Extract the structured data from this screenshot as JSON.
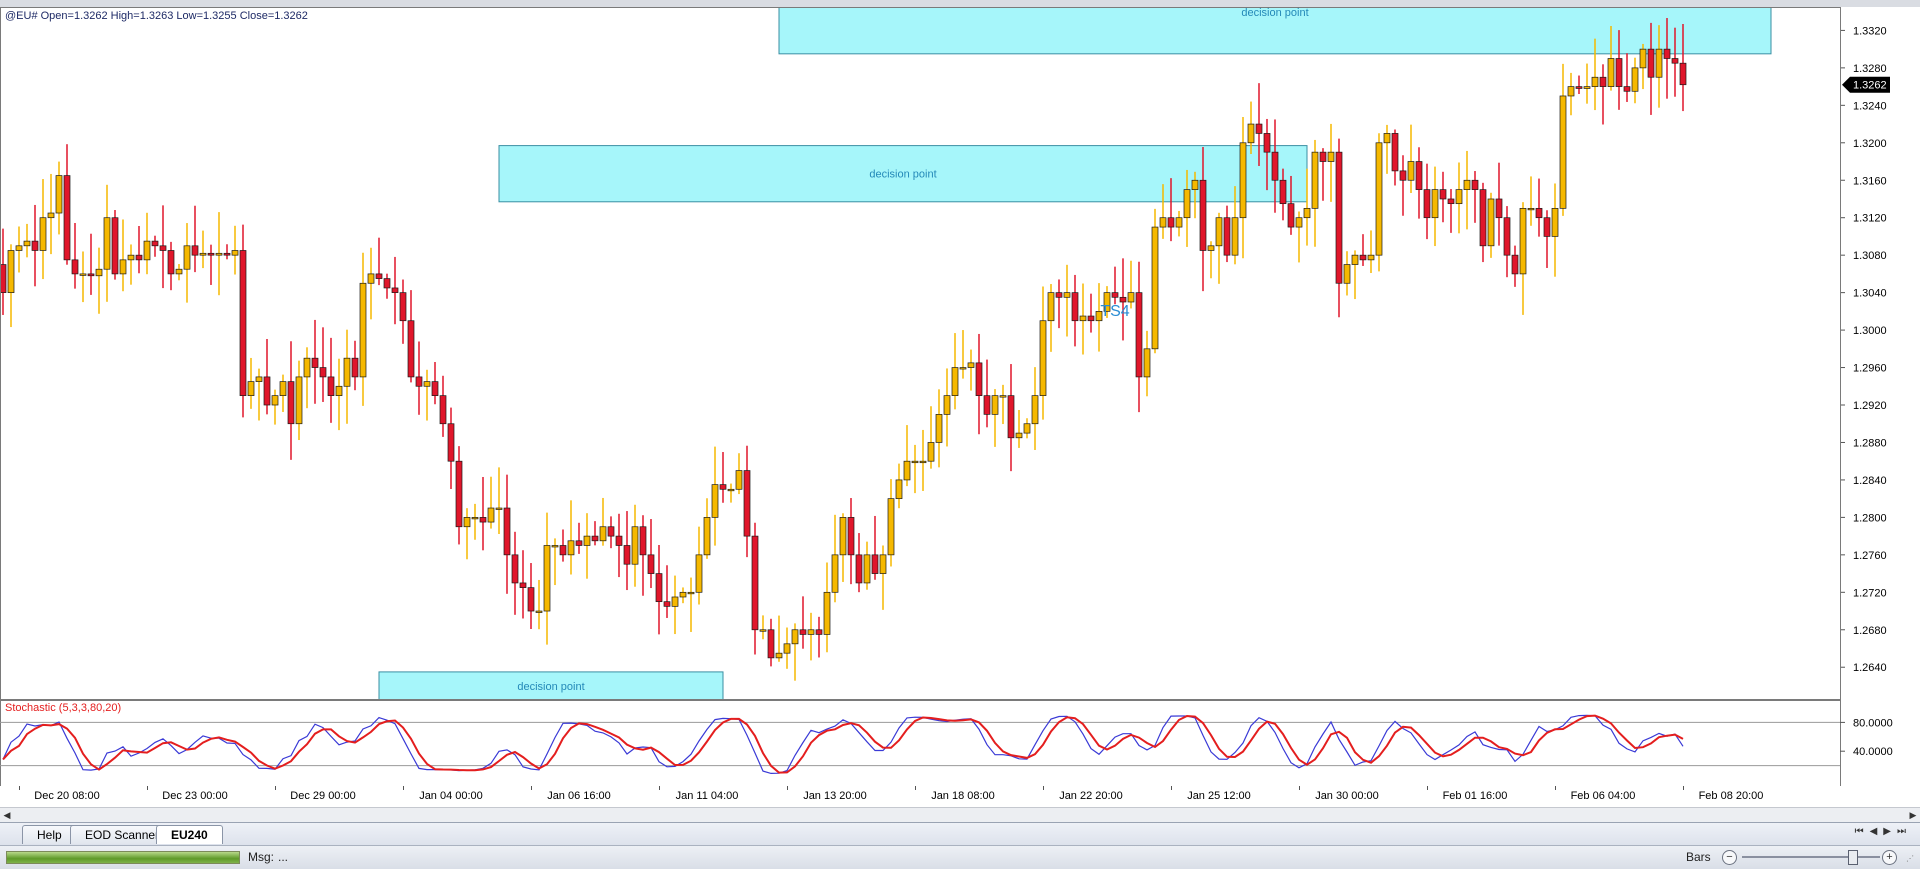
{
  "header": {
    "symbol": "@EU#",
    "ohlc": "Open=1.3262  High=1.3263  Low=1.3255  Close=1.3262"
  },
  "colors": {
    "bull": "#f5b800",
    "bear": "#e0162b",
    "zone": "#a6f6fa",
    "zone_border": "#3b8fa3",
    "zone_text": "#2489b8",
    "stoch_k": "#3a3ad6",
    "stoch_d": "#e41e1e",
    "annotation": "#2a8dd4"
  },
  "chart_data": {
    "type": "candlestick",
    "symbol": "@EU#",
    "ylim": [
      1.2605,
      1.3345
    ],
    "y_ticks": [
      "1.3320",
      "1.3280",
      "1.3240",
      "1.3200",
      "1.3160",
      "1.3120",
      "1.3080",
      "1.3040",
      "1.3000",
      "1.2960",
      "1.2920",
      "1.2880",
      "1.2840",
      "1.2800",
      "1.2760",
      "1.2720",
      "1.2680",
      "1.2640"
    ],
    "last_price": "1.3262",
    "x_labels": [
      "Dec 20 08:00",
      "Dec 23 00:00",
      "Dec 29 00:00",
      "Jan 04 00:00",
      "Jan 06 16:00",
      "Jan 11 04:00",
      "Jan 13 20:00",
      "Jan 18 08:00",
      "Jan 22 20:00",
      "Jan 25 12:00",
      "Jan 30 00:00",
      "Feb 01 16:00",
      "Feb 06 04:00",
      "Feb 08 20:00"
    ],
    "x_label_bars": [
      2,
      18,
      34,
      50,
      66,
      82,
      98,
      114,
      130,
      146,
      162,
      178,
      194,
      210
    ],
    "closes": [
      1.304,
      1.3085,
      1.309,
      1.3095,
      1.3085,
      1.312,
      1.3125,
      1.3165,
      1.3075,
      1.306,
      1.306,
      1.3058,
      1.3065,
      1.312,
      1.306,
      1.3075,
      1.308,
      1.3075,
      1.3095,
      1.309,
      1.3085,
      1.306,
      1.3065,
      1.309,
      1.308,
      1.3082,
      1.308,
      1.3082,
      1.308,
      1.3085,
      1.293,
      1.2945,
      1.295,
      1.292,
      1.293,
      1.2945,
      1.29,
      1.295,
      1.297,
      1.296,
      1.295,
      1.293,
      1.294,
      1.297,
      1.295,
      1.305,
      1.306,
      1.3055,
      1.3045,
      1.304,
      1.301,
      1.295,
      1.294,
      1.2945,
      1.293,
      1.29,
      1.286,
      1.279,
      1.28,
      1.28,
      1.2795,
      1.281,
      1.281,
      1.276,
      1.273,
      1.2725,
      1.27,
      1.27,
      1.277,
      1.277,
      1.276,
      1.2775,
      1.277,
      1.278,
      1.2775,
      1.279,
      1.278,
      1.277,
      1.275,
      1.279,
      1.276,
      1.274,
      1.271,
      1.2705,
      1.2715,
      1.272,
      1.272,
      1.276,
      1.28,
      1.2835,
      1.283,
      1.283,
      1.285,
      1.278,
      1.268,
      1.268,
      1.265,
      1.2655,
      1.2665,
      1.268,
      1.2675,
      1.268,
      1.2675,
      1.272,
      1.276,
      1.28,
      1.276,
      1.273,
      1.276,
      1.274,
      1.276,
      1.282,
      1.284,
      1.286,
      1.286,
      1.286,
      1.288,
      1.291,
      1.293,
      1.296,
      1.296,
      1.2965,
      1.293,
      1.291,
      1.293,
      1.293,
      1.2885,
      1.289,
      1.29,
      1.293,
      1.301,
      1.304,
      1.3035,
      1.304,
      1.301,
      1.3015,
      1.301,
      1.302,
      1.304,
      1.3035,
      1.303,
      1.304,
      1.295,
      1.298,
      1.311,
      1.312,
      1.311,
      1.312,
      1.315,
      1.316,
      1.3085,
      1.309,
      1.312,
      1.308,
      1.312,
      1.32,
      1.322,
      1.321,
      1.319,
      1.316,
      1.3135,
      1.311,
      1.312,
      1.313,
      1.319,
      1.318,
      1.319,
      1.305,
      1.307,
      1.308,
      1.3075,
      1.308,
      1.32,
      1.321,
      1.317,
      1.316,
      1.318,
      1.315,
      1.312,
      1.315,
      1.314,
      1.3135,
      1.315,
      1.316,
      1.315,
      1.309,
      1.314,
      1.312,
      1.308,
      1.306,
      1.313,
      1.313,
      1.312,
      1.31,
      1.313,
      1.325,
      1.326,
      1.3258,
      1.326,
      1.327,
      1.326,
      1.329,
      1.326,
      1.3255,
      1.328,
      1.33,
      1.327,
      1.33,
      1.329,
      1.3285,
      1.3262
    ],
    "zones": [
      {
        "label": "decision point",
        "top": 1.3345,
        "bottom": 1.3295,
        "from_bar": 97,
        "to_bar": 221
      },
      {
        "label": "decision point",
        "top": 1.3197,
        "bottom": 1.3137,
        "from_bar": 62,
        "to_bar": 163
      },
      {
        "label": "decision point",
        "top": 1.2635,
        "bottom": 1.2605,
        "from_bar": 47,
        "to_bar": 90
      }
    ],
    "annotations": [
      {
        "text": "TS4",
        "bar": 139,
        "price": 1.3015
      }
    ],
    "oscillator": {
      "name": "Stochastic (5,3,3,80,20)",
      "ylim": [
        0,
        100
      ],
      "y_ticks": [
        "80.0000",
        "40.0000"
      ],
      "levels": [
        80,
        20
      ]
    }
  },
  "tabs": [
    {
      "label": "Help",
      "active": false
    },
    {
      "label": "EOD Scanner",
      "active": false
    },
    {
      "label": "EU240",
      "active": true
    }
  ],
  "status": {
    "msg_label": "Msg:",
    "msg_value": "...",
    "bars_label": "Bars"
  }
}
